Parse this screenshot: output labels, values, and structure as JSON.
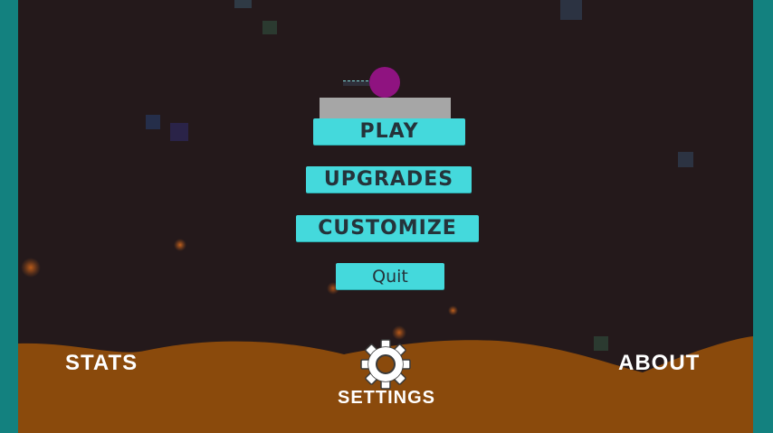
{
  "menu": {
    "play_label": "PLAY",
    "upgrades_label": "UPGRADES",
    "customize_label": "CUSTOMIZE",
    "quit_label": "Quit"
  },
  "footer": {
    "stats_label": "STATS",
    "settings_label": "SETTINGS",
    "about_label": "ABOUT"
  },
  "colors": {
    "background": "#24191b",
    "frame": "#13817f",
    "button": "#44d9dc",
    "button_text": "#25333a",
    "ground": "#8a4a0c",
    "player": "#8f1380",
    "platform": "#a6a6a6"
  },
  "icons": {
    "settings": "gear-icon"
  }
}
